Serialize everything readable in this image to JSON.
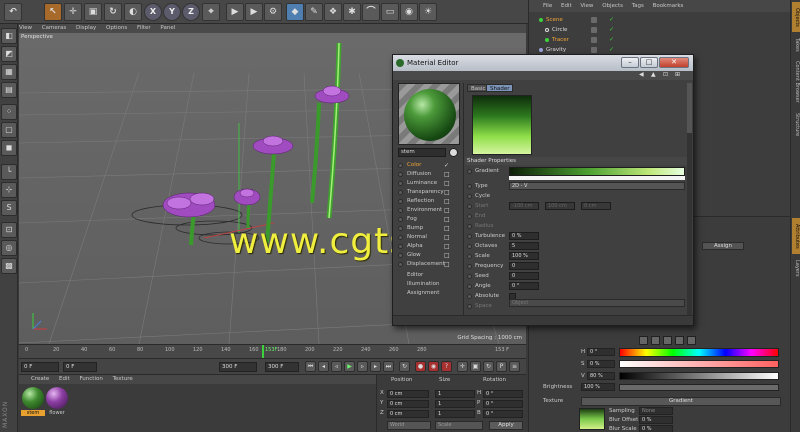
{
  "viewport": {
    "menu": [
      "View",
      "Cameras",
      "Display",
      "Options",
      "Filter",
      "Panel"
    ],
    "label": "Perspective",
    "grid_spacing": "Grid Spacing : 1000 cm"
  },
  "watermark": "www.cgtsj.com",
  "toolbar": {
    "axis_x": "X",
    "axis_y": "Y",
    "axis_z": "Z"
  },
  "timeline": {
    "ticks": [
      "0",
      "20",
      "40",
      "60",
      "80",
      "100",
      "120",
      "140",
      "160",
      "180",
      "200",
      "220",
      "240",
      "260",
      "280"
    ],
    "playhead_label": "153F",
    "end_label": "153 F"
  },
  "transport": {
    "start_frame": "0 F",
    "current_frame": "0 F",
    "min_frame": "300 F",
    "max_frame": "300 F"
  },
  "material_manager": {
    "menu": [
      "Create",
      "Edit",
      "Function",
      "Texture"
    ],
    "materials": [
      {
        "name": "stem",
        "color": "#3f8a2f"
      },
      {
        "name": "flower",
        "color": "#8d3fa4"
      }
    ]
  },
  "coordinates": {
    "headers": [
      "Position",
      "Size",
      "Rotation"
    ],
    "axes": [
      "X",
      "Y",
      "Z"
    ],
    "position": [
      "0 cm",
      "0 cm",
      "0 cm"
    ],
    "size": [
      "1",
      "1",
      "1"
    ],
    "rotation_labels": [
      "H",
      "P",
      "B"
    ],
    "rotation": [
      "0 °",
      "0 °",
      "0 °"
    ],
    "mode_select": "World",
    "size_select": "Scale",
    "apply": "Apply"
  },
  "object_manager": {
    "menu": [
      "File",
      "Edit",
      "View",
      "Objects",
      "Tags",
      "Bookmarks"
    ],
    "objects": [
      {
        "name": "Scene",
        "selected": true
      },
      {
        "name": "Circle",
        "selected": false
      },
      {
        "name": "Tracer",
        "selected": true
      },
      {
        "name": "Gravity",
        "selected": false
      }
    ]
  },
  "right_tabs": [
    "Objects",
    "Takes",
    "Content Browser",
    "Structure",
    "Attributes",
    "Layers"
  ],
  "attributes": {
    "assign": "Assign",
    "h_label": "H",
    "h_value": "0 °",
    "s_label": "S",
    "s_value": "0 %",
    "v_label": "V",
    "v_value": "80 %",
    "brightness_label": "Brightness",
    "brightness_value": "100 %",
    "texture_label": "Texture",
    "texture_button": "Gradient",
    "sampling_label": "Sampling",
    "sampling_value": "None",
    "blur_offset_label": "Blur Offset",
    "blur_offset_value": "0 %",
    "blur_scale_label": "Blur Scale",
    "blur_scale_value": "0 %"
  },
  "material_editor": {
    "title": "Material Editor",
    "material_name": "stem",
    "tabs": [
      "Basic",
      "Shader"
    ],
    "channels": [
      {
        "label": "Color",
        "checked": true,
        "selected": true
      },
      {
        "label": "Diffusion",
        "checked": false,
        "selected": false
      },
      {
        "label": "Luminance",
        "checked": false,
        "selected": false
      },
      {
        "label": "Transparency",
        "checked": false,
        "selected": false
      },
      {
        "label": "Reflection",
        "checked": false,
        "selected": false
      },
      {
        "label": "Environment",
        "checked": false,
        "selected": false
      },
      {
        "label": "Fog",
        "checked": false,
        "selected": false
      },
      {
        "label": "Bump",
        "checked": false,
        "selected": false
      },
      {
        "label": "Normal",
        "checked": false,
        "selected": false
      },
      {
        "label": "Alpha",
        "checked": false,
        "selected": false
      },
      {
        "label": "Glow",
        "checked": false,
        "selected": false
      },
      {
        "label": "Displacement",
        "checked": false,
        "selected": false
      }
    ],
    "extra_items": [
      "Editor",
      "Illumination",
      "Assignment"
    ],
    "shader_properties_header": "Shader Properties",
    "gradient_label": "Gradient",
    "type_label": "Type",
    "type_value": "2D - V",
    "cycle_label": "Cycle",
    "start_label": "Start",
    "start_value": "-100 cm",
    "end_label": "End",
    "end_value": "100 cm",
    "radius_label": "Radius",
    "radius_value": "0 cm",
    "turbulence_label": "Turbulence",
    "turbulence_value": "0 %",
    "octaves_label": "Octaves",
    "octaves_value": "5",
    "scale_label": "Scale",
    "scale_value": "100 %",
    "frequency_label": "Frequency",
    "frequency_value": "0",
    "seed_label": "Seed",
    "seed_value": "0",
    "angle_label": "Angle",
    "angle_value": "0 °",
    "absolute_label": "Absolute",
    "space_label": "Space",
    "space_value": "Object"
  },
  "colors": {
    "accent": "#f2a53a",
    "stem_green": "#3f8a2f",
    "flower_purple": "#a04bc0",
    "watermark_yellow": "#f0ee3e"
  }
}
